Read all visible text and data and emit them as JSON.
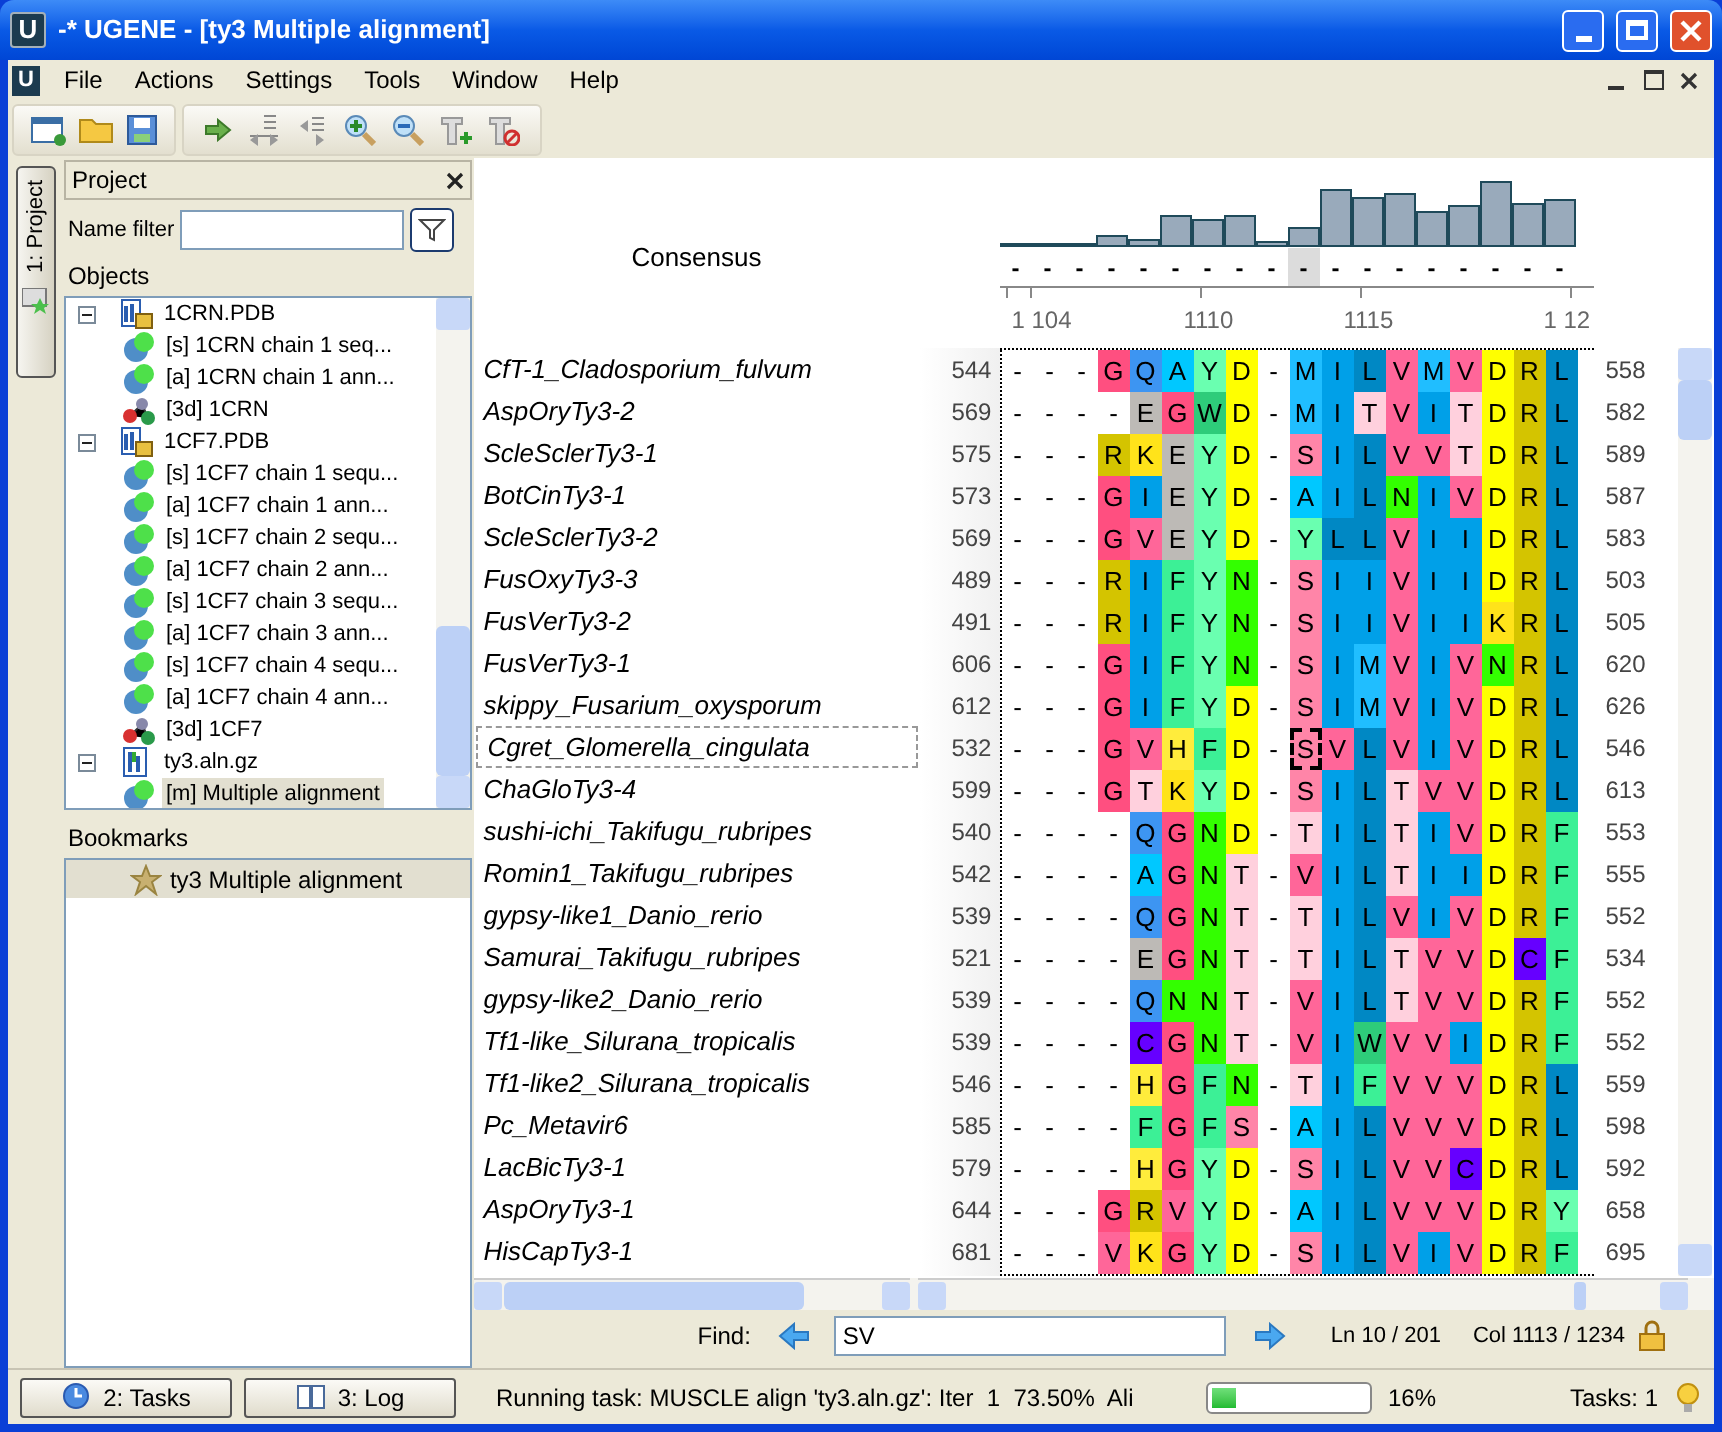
{
  "window": {
    "logo": "U",
    "title": "-* UGENE - [ty3 Multiple alignment]"
  },
  "menu_logo": "U",
  "menu": [
    "File",
    "Actions",
    "Settings",
    "Tools",
    "Window",
    "Help"
  ],
  "side_tab": {
    "label": "1: Project",
    "selected": true
  },
  "project": {
    "title": "Project",
    "filter_label": "Name filter",
    "objects_label": "Objects",
    "bookmarks_label": "Bookmarks",
    "tree": [
      {
        "label": "1CRN.PDB",
        "kind": "doc",
        "expanded": true,
        "selected": false,
        "children": [
          {
            "label": "[s] 1CRN chain 1 seq...",
            "kind": "object",
            "selected": false
          },
          {
            "label": "[a] 1CRN chain 1 ann...",
            "kind": "object",
            "selected": false
          },
          {
            "label": "[3d] 1CRN",
            "kind": "structure",
            "selected": false
          }
        ]
      },
      {
        "label": "1CF7.PDB",
        "kind": "doc",
        "expanded": true,
        "selected": false,
        "children": [
          {
            "label": "[s] 1CF7 chain 1 sequ...",
            "kind": "object",
            "selected": false
          },
          {
            "label": "[a] 1CF7 chain 1 ann...",
            "kind": "object",
            "selected": false
          },
          {
            "label": "[s] 1CF7 chain 2 sequ...",
            "kind": "object",
            "selected": false
          },
          {
            "label": "[a] 1CF7 chain 2 ann...",
            "kind": "object",
            "selected": false
          },
          {
            "label": "[s] 1CF7 chain 3 sequ...",
            "kind": "object",
            "selected": false
          },
          {
            "label": "[a] 1CF7 chain 3 ann...",
            "kind": "object",
            "selected": false
          },
          {
            "label": "[s] 1CF7 chain 4 sequ...",
            "kind": "object",
            "selected": false
          },
          {
            "label": "[a] 1CF7 chain 4 ann...",
            "kind": "object",
            "selected": false
          },
          {
            "label": "[3d] 1CF7",
            "kind": "structure",
            "selected": false
          }
        ]
      },
      {
        "label": "ty3.aln.gz",
        "kind": "alignment-doc",
        "expanded": true,
        "selected": false,
        "children": [
          {
            "label": "[m] Multiple alignment",
            "kind": "object",
            "selected": true
          }
        ]
      }
    ],
    "bookmarks": [
      {
        "label": "ty3 Multiple alignment",
        "selected": true
      }
    ]
  },
  "msa": {
    "consensus_label": "Consensus",
    "consensus": [
      {
        "text": "-",
        "selected": false
      },
      {
        "text": "-",
        "selected": false
      },
      {
        "text": "-",
        "selected": false
      },
      {
        "text": "-",
        "selected": false
      },
      {
        "text": "-",
        "selected": false
      },
      {
        "text": "-",
        "selected": false
      },
      {
        "text": "-",
        "selected": false
      },
      {
        "text": "-",
        "selected": false
      },
      {
        "text": "-",
        "selected": false
      },
      {
        "text": "-",
        "selected": true
      },
      {
        "text": "-",
        "selected": false
      },
      {
        "text": "-",
        "selected": false
      },
      {
        "text": "-",
        "selected": false
      },
      {
        "text": "-",
        "selected": false
      },
      {
        "text": "-",
        "selected": false
      },
      {
        "text": "-",
        "selected": false
      },
      {
        "text": "-",
        "selected": false
      },
      {
        "text": "-",
        "selected": false
      }
    ],
    "ruler": [
      "1 104",
      "1110",
      "1115",
      "1 12"
    ],
    "rows": [
      {
        "name": "CfT-1_Cladosporium_fulvum",
        "start": "544",
        "seq": "- - - G Q A Y D - M I L V M V D R L",
        "end": "558",
        "selected": false
      },
      {
        "name": "AspOryTy3-2",
        "start": "569",
        "seq": "- - - - E G W D - M I T V I T D R L",
        "end": "582",
        "selected": false
      },
      {
        "name": "ScleSclerTy3-1",
        "start": "575",
        "seq": "- - - R K E Y D - S I L V V T D R L",
        "end": "589",
        "selected": false
      },
      {
        "name": "BotCinTy3-1",
        "start": "573",
        "seq": "- - - G I E Y D - A I L N I V D R L",
        "end": "587",
        "selected": false
      },
      {
        "name": "ScleSclerTy3-2",
        "start": "569",
        "seq": "- - - G V E Y D - Y L L V I I D R L",
        "end": "583",
        "selected": false
      },
      {
        "name": "FusOxyTy3-3",
        "start": "489",
        "seq": "- - - R I F Y N - S I I V I I D R L",
        "end": "503",
        "selected": false
      },
      {
        "name": "FusVerTy3-2",
        "start": "491",
        "seq": "- - - R I F Y N - S I I V I I K R L",
        "end": "505",
        "selected": false
      },
      {
        "name": "FusVerTy3-1",
        "start": "606",
        "seq": "- - - G I F Y N - S I M V I V N R L",
        "end": "620",
        "selected": false
      },
      {
        "name": "skippy_Fusarium_oxysporum",
        "start": "612",
        "seq": "- - - G I F Y D - S I M V I V D R L",
        "end": "626",
        "selected": false
      },
      {
        "name": "Cgret_Glomerella_cingulata",
        "start": "532",
        "seq": "- - - G V H F D - S V L V I V D R L",
        "end": "546",
        "selected": true
      },
      {
        "name": "ChaGloTy3-4",
        "start": "599",
        "seq": "- - - G T K Y D - S I L T V V D R L",
        "end": "613",
        "selected": false
      },
      {
        "name": "sushi-ichi_Takifugu_rubripes",
        "start": "540",
        "seq": "- - - - Q G N D - T I L T I V D R F",
        "end": "553",
        "selected": false
      },
      {
        "name": "Romin1_Takifugu_rubripes",
        "start": "542",
        "seq": "- - - - A G N T - V I L T I I D R F",
        "end": "555",
        "selected": false
      },
      {
        "name": "gypsy-like1_Danio_rerio",
        "start": "539",
        "seq": "- - - - Q G N T - T I L V I V D R F",
        "end": "552",
        "selected": false
      },
      {
        "name": "Samurai_Takifugu_rubripes",
        "start": "521",
        "seq": "- - - - E G N T - T I L T V V D C F",
        "end": "534",
        "selected": false
      },
      {
        "name": "gypsy-like2_Danio_rerio",
        "start": "539",
        "seq": "- - - - Q N N T - V I L T V V D R F",
        "end": "552",
        "selected": false
      },
      {
        "name": "Tf1-like_Silurana_tropicalis",
        "start": "539",
        "seq": "- - - - C G N T - V I W V V I D R F",
        "end": "552",
        "selected": false
      },
      {
        "name": "Tf1-like2_Silurana_tropicalis",
        "start": "546",
        "seq": "- - - - H G F N - T I F V V V D R L",
        "end": "559",
        "selected": false
      },
      {
        "name": "Pc_Metavir6",
        "start": "585",
        "seq": "- - - - F G F S - A I L V V V D R L",
        "end": "598",
        "selected": false
      },
      {
        "name": "LacBicTy3-1",
        "start": "579",
        "seq": "- - - - H G Y D - S I L V V C D R L",
        "end": "592",
        "selected": false
      },
      {
        "name": "AspOryTy3-1",
        "start": "644",
        "seq": "- - - G R V Y D - A I L V V V D R Y",
        "end": "658",
        "selected": false
      },
      {
        "name": "HisCapTy3-1",
        "start": "681",
        "seq": "- - - V K G Y D - S I L V I V D R F",
        "end": "695",
        "selected": false
      }
    ]
  },
  "find": {
    "label": "Find:",
    "value": "SV"
  },
  "position": {
    "line": "Ln 10 / 201",
    "column": "Col 1113 / 1234"
  },
  "bottom_tabs": [
    {
      "label": "2: Tasks",
      "kind": "tasks"
    },
    {
      "label": "3: Log",
      "kind": "log"
    }
  ],
  "status": {
    "task": "Running task: MUSCLE align 'ty3.aln.gz': Iter  1  73.50%  Ali",
    "level": 0.16,
    "percent": "16%",
    "tasks": "Tasks: 1"
  }
}
